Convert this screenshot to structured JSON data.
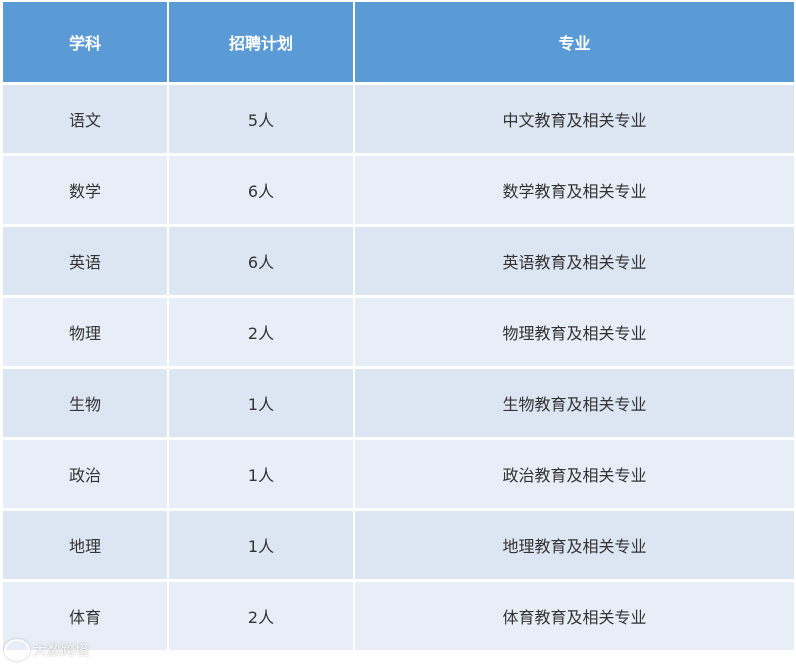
{
  "headers": [
    "学科",
    "招聘计划",
    "专业"
  ],
  "rows": [
    [
      "语文",
      "5人",
      "中文教育及相关专业"
    ],
    [
      "数学",
      "6人",
      "数学教育及相关专业"
    ],
    [
      "英语",
      "6人",
      "英语教育及相关专业"
    ],
    [
      "物理",
      "2人",
      "物理教育及相关专业"
    ],
    [
      "生物",
      "1人",
      "生物教育及相关专业"
    ],
    [
      "政治",
      "1人",
      "政治教育及相关专业"
    ],
    [
      "地理",
      "1人",
      "地理教育及相关专业"
    ],
    [
      "体育",
      "2人",
      "体育教育及相关专业"
    ]
  ],
  "watermark": "大数跨境",
  "colors": {
    "header_bg": "#5b9bd5",
    "row_odd": "#dce6f2",
    "row_even": "#e8eef7"
  }
}
